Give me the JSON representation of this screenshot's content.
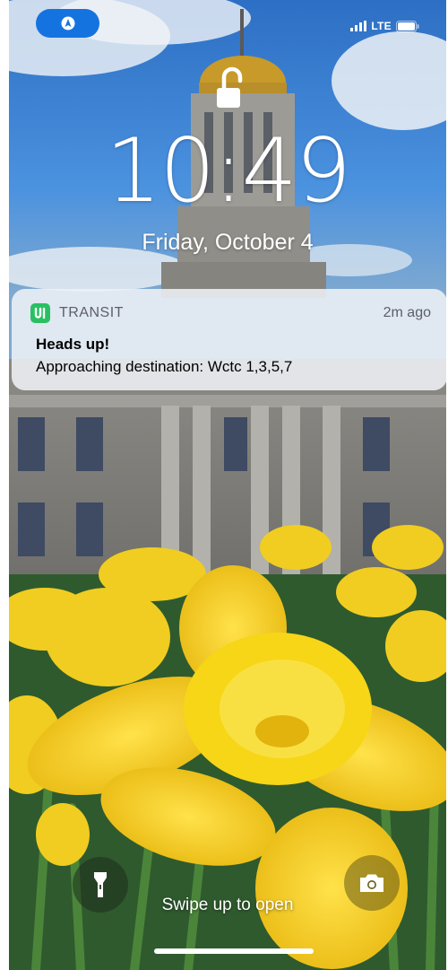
{
  "status_bar": {
    "network": "LTE",
    "location_icon": "location-arrow-icon",
    "signal_icon": "signal-bars-icon",
    "battery_icon": "battery-icon"
  },
  "lock_screen": {
    "lock_icon": "unlocked-padlock-icon",
    "time": "10:49",
    "date": "Friday, October 4"
  },
  "notification": {
    "app_name": "TRANSIT",
    "app_icon": "transit-app-icon",
    "time_ago": "2m ago",
    "title": "Heads up!",
    "body": "Approaching destination: Wctc 1,3,5,7"
  },
  "bottom": {
    "flashlight_icon": "flashlight-icon",
    "camera_icon": "camera-icon",
    "hint": "Swipe up to open"
  },
  "colors": {
    "location_pill": "#1573e0",
    "transit_green": "#29c062",
    "daffodil_yellow": "#f3d21d",
    "sky_blue": "#2f77c9"
  }
}
